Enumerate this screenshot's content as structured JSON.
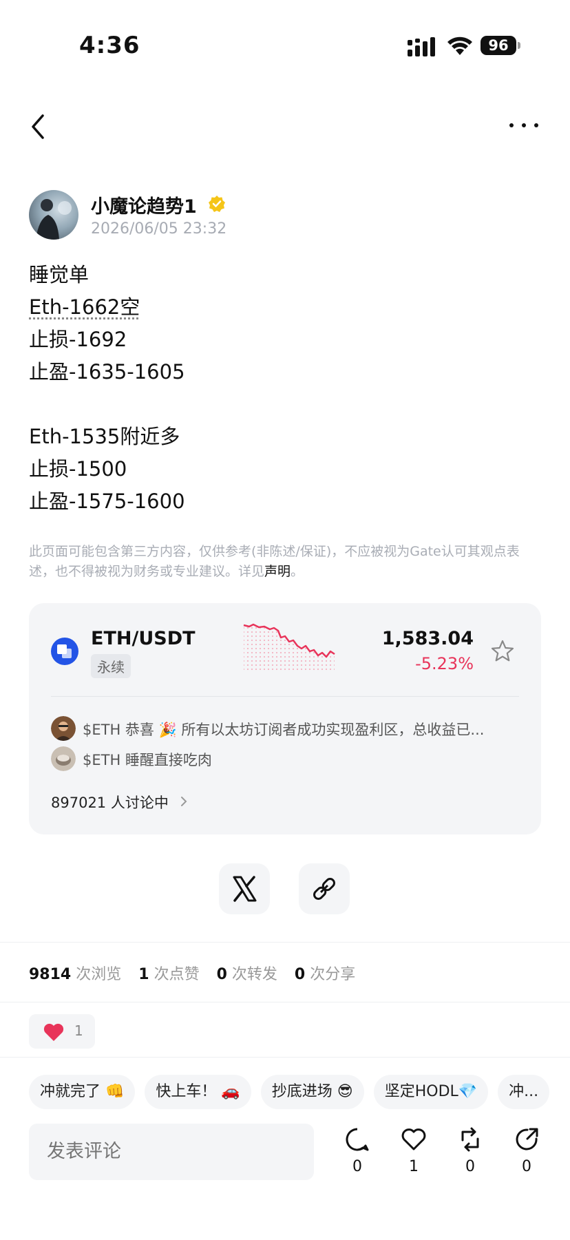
{
  "status_bar": {
    "time": "4:36",
    "battery": "96"
  },
  "post": {
    "author": "小魔论趋势1",
    "timestamp": "2026/06/05 23:32",
    "lines": [
      "睡觉单",
      "Eth-1662空",
      "止损-1692",
      "止盈-1635-1605",
      "",
      "Eth-1535附近多",
      "止损-1500",
      "止盈-1575-1600"
    ],
    "disclaimer_text": "此页面可能包含第三方内容，仅供参考(非陈述/保证)，不应被视为Gate认可其观点表述，也不得被视为财务或专业建议。详见",
    "disclaimer_link": "声明",
    "disclaimer_end": "。"
  },
  "market": {
    "pair": "ETH/USDT",
    "tag": "永续",
    "price": "1,583.04",
    "change": "-5.23%",
    "accent_down": "#e8345a",
    "discussions": [
      "$ETH  恭喜 🎉 所有以太坊订阅者成功实现盈利区，总收益已...",
      "$ETH 睡醒直接吃肉"
    ],
    "discuss_count": "897021 人讨论中"
  },
  "stats": {
    "views": "9814",
    "views_label": "次浏览",
    "likes": "1",
    "likes_label": "次点赞",
    "reposts": "0",
    "reposts_label": "次转发",
    "shares": "0",
    "shares_label": "次分享"
  },
  "reaction": {
    "heart_count": "1"
  },
  "quick_replies": [
    "冲就完了 👊",
    "快上车！ 🚗",
    "抄底进场 😎",
    "坚定HODL💎",
    "冲..."
  ],
  "bottom_bar": {
    "comment_placeholder": "发表评论",
    "comment_count": "0",
    "like_count": "1",
    "repost_count": "0",
    "share_count": "0"
  },
  "icons": [
    "back-icon",
    "more-icon",
    "verified-icon",
    "star-icon",
    "x-logo-icon",
    "link-icon",
    "heart-icon",
    "comment-icon",
    "repost-icon",
    "share-icon"
  ]
}
